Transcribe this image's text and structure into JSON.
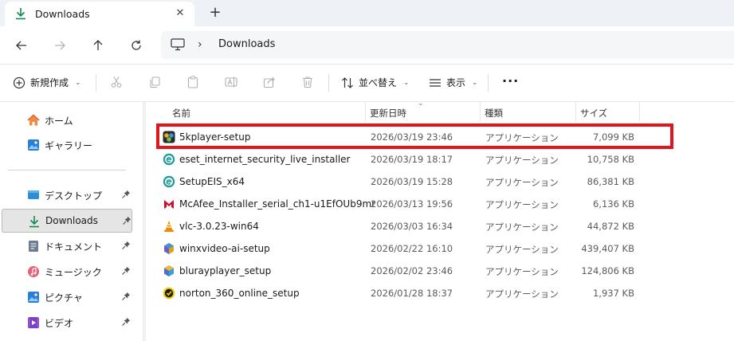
{
  "tab": {
    "title": "Downloads",
    "close": "✕",
    "new": "+"
  },
  "address": {
    "separator": "›",
    "path": "Downloads"
  },
  "commands": {
    "new_label": "新規作成",
    "sort_label": "並べ替え",
    "view_label": "表示",
    "chevron": "⌄",
    "more": "···"
  },
  "sidebar": {
    "items": [
      {
        "label": "ホーム"
      },
      {
        "label": "ギャラリー"
      },
      {
        "label": "デスクトップ"
      },
      {
        "label": "Downloads"
      },
      {
        "label": "ドキュメント"
      },
      {
        "label": "ミュージック"
      },
      {
        "label": "ピクチャ"
      },
      {
        "label": "ビデオ"
      }
    ]
  },
  "columns": {
    "name": "名前",
    "date": "更新日時",
    "type": "種類",
    "size": "サイズ",
    "sort_caret": "⌄"
  },
  "files": [
    {
      "name": "5kplayer-setup",
      "date": "2026/03/19 23:46",
      "type": "アプリケーション",
      "size": "7,099 KB"
    },
    {
      "name": "eset_internet_security_live_installer",
      "date": "2026/03/19 18:17",
      "type": "アプリケーション",
      "size": "10,758 KB"
    },
    {
      "name": "SetupEIS_x64",
      "date": "2026/03/19 15:28",
      "type": "アプリケーション",
      "size": "86,381 KB"
    },
    {
      "name": "McAfee_Installer_serial_ch1-u1EfOUb9mr...",
      "date": "2026/03/13 19:56",
      "type": "アプリケーション",
      "size": "6,136 KB"
    },
    {
      "name": "vlc-3.0.23-win64",
      "date": "2026/03/03 16:34",
      "type": "アプリケーション",
      "size": "44,872 KB"
    },
    {
      "name": "winxvideo-ai-setup",
      "date": "2026/02/22 16:10",
      "type": "アプリケーション",
      "size": "439,407 KB"
    },
    {
      "name": "blurayplayer_setup",
      "date": "2026/02/02 23:46",
      "type": "アプリケーション",
      "size": "124,806 KB"
    },
    {
      "name": "norton_360_online_setup",
      "date": "2026/01/28 18:37",
      "type": "アプリケーション",
      "size": "1,937 KB"
    }
  ],
  "colors": {
    "accent": "#0f8a52",
    "highlight_box": "#e0161f"
  }
}
